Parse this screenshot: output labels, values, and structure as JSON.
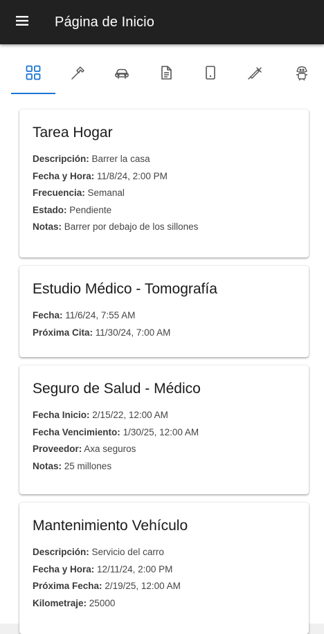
{
  "appbar": {
    "title": "Página de Inicio",
    "menu_icon": "hamburger-menu-icon"
  },
  "tabs": [
    {
      "icon": "grid-icon",
      "selected": true
    },
    {
      "icon": "hammer-icon",
      "selected": false
    },
    {
      "icon": "car-icon",
      "selected": false
    },
    {
      "icon": "document-icon",
      "selected": false
    },
    {
      "icon": "mobile-phone-icon",
      "selected": false
    },
    {
      "icon": "syringe-icon",
      "selected": false
    },
    {
      "icon": "dog-icon",
      "selected": false
    }
  ],
  "accent_color": "#1976d2",
  "cards": [
    {
      "title": "Tarea Hogar",
      "fields": [
        {
          "label": "Descripción:",
          "value": "Barrer la casa"
        },
        {
          "label": "Fecha y Hora:",
          "value": "11/8/24, 2:00 PM"
        },
        {
          "label": "Frecuencia:",
          "value": "Semanal"
        },
        {
          "label": "Estado:",
          "value": "Pendiente"
        },
        {
          "label": "Notas:",
          "value": "Barrer por debajo de los sillones"
        }
      ]
    },
    {
      "title": "Estudio Médico - Tomografía",
      "fields": [
        {
          "label": "Fecha:",
          "value": "11/6/24, 7:55 AM"
        },
        {
          "label": "Próxima Cita:",
          "value": "11/30/24, 7:00 AM"
        }
      ]
    },
    {
      "title": "Seguro de Salud - Médico",
      "fields": [
        {
          "label": "Fecha Inicio:",
          "value": "2/15/22, 12:00 AM"
        },
        {
          "label": "Fecha Vencimiento:",
          "value": "1/30/25, 12:00 AM"
        },
        {
          "label": "Proveedor:",
          "value": "Axa seguros"
        },
        {
          "label": "Notas:",
          "value": "25 millones"
        }
      ]
    },
    {
      "title": "Mantenimiento Vehículo",
      "fields": [
        {
          "label": "Descripción:",
          "value": "Servicio del carro"
        },
        {
          "label": "Fecha y Hora:",
          "value": "12/11/24, 2:00 PM"
        },
        {
          "label": "Próxima Fecha:",
          "value": "2/19/25, 12:00 AM"
        },
        {
          "label": "Kilometraje:",
          "value": "25000"
        }
      ]
    }
  ]
}
